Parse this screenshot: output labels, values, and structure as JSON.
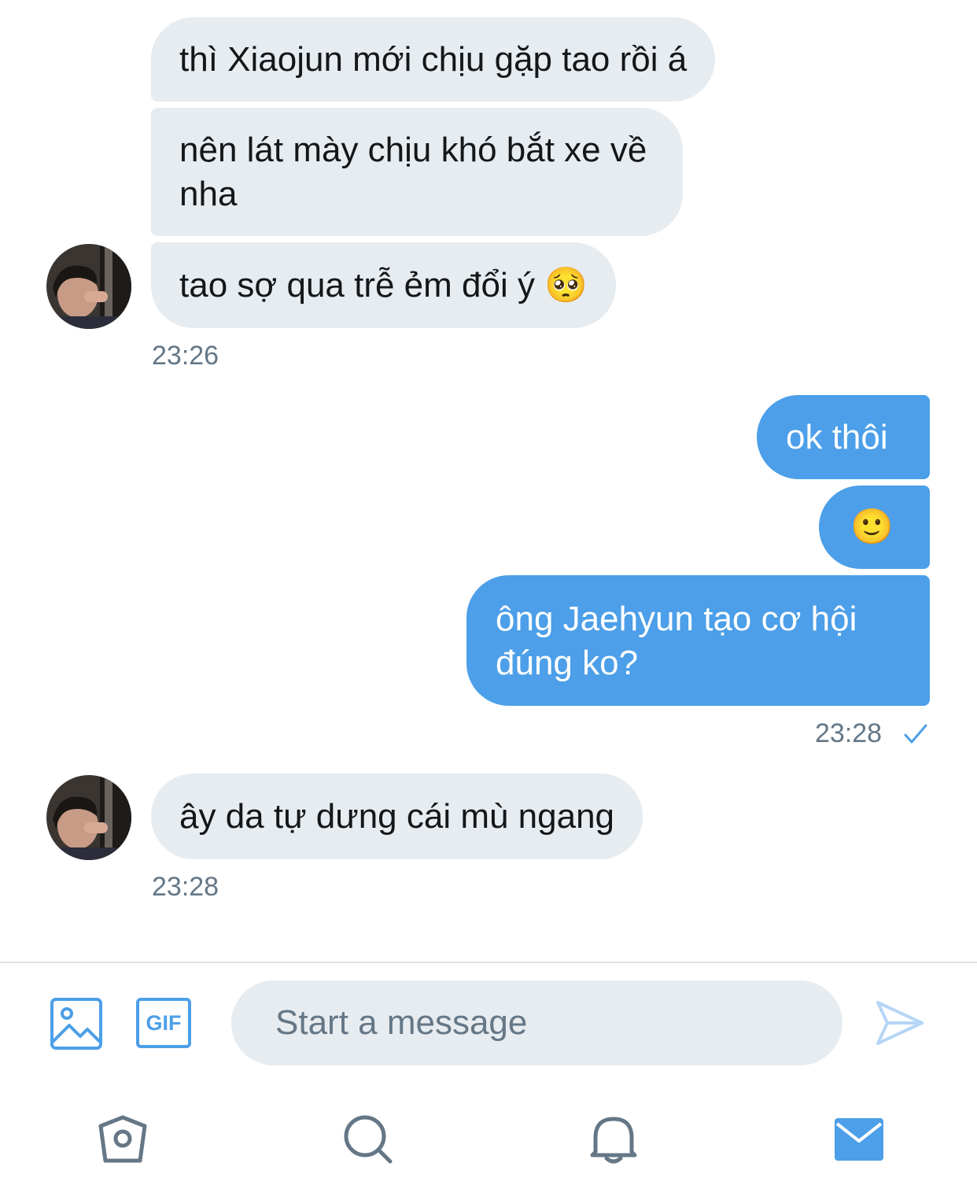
{
  "messages": [
    {
      "side": "received",
      "text": "thì Xiaojun mới chịu gặp tao rồi á"
    },
    {
      "side": "received",
      "text": "nên lát mày chịu khó bắt xe về nha"
    },
    {
      "side": "received",
      "text": "tao sợ qua trễ ẻm đổi ý 🥺"
    },
    {
      "side": "sent",
      "text": "ok thôi"
    },
    {
      "side": "sent",
      "text": "🙂"
    },
    {
      "side": "sent",
      "text": "ông Jaehyun tạo cơ hội đúng ko?"
    },
    {
      "side": "received",
      "text": "ây da tự dưng cái mù ngang"
    }
  ],
  "timestamps": {
    "received_group_1": "23:26",
    "sent_group": "23:28",
    "received_group_2": "23:28"
  },
  "composer": {
    "placeholder": "Start a message",
    "gif_label": "GIF"
  },
  "icons": {
    "image": "image-icon",
    "gif": "gif-icon",
    "send": "send-icon",
    "home": "home-icon",
    "search": "search-icon",
    "notifications": "bell-icon",
    "messages": "mail-icon",
    "read_receipt": "checkmark-icon"
  },
  "colors": {
    "accent": "#4c9fe8",
    "received_bubble": "#e6ecf0",
    "timestamp": "#657786"
  }
}
